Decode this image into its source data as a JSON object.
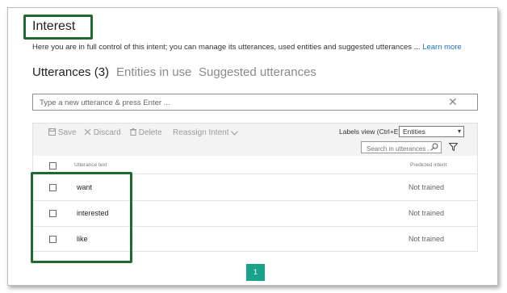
{
  "intent": {
    "title": "Interest",
    "description": "Here you are in full control of this intent; you can manage its utterances, used entities and suggested utterances ...",
    "learn_more": "Learn more"
  },
  "tabs": [
    {
      "label": "Utterances (3)",
      "active": true
    },
    {
      "label": "Entities in use",
      "active": false
    },
    {
      "label": "Suggested utterances",
      "active": false
    }
  ],
  "utterance_input": {
    "placeholder": "Type a new utterance & press Enter ...",
    "value": ""
  },
  "toolbar": {
    "save": "Save",
    "discard": "Discard",
    "delete": "Delete",
    "reassign": "Reassign Intent",
    "labels_view_label": "Labels view (Ctrl+E):",
    "labels_view_value": "Entities",
    "search_placeholder": "Search in utterances ..."
  },
  "table": {
    "columns": [
      "Utterance text",
      "Predicted intent"
    ],
    "rows": [
      {
        "text": "want",
        "status": "Not trained"
      },
      {
        "text": "interested",
        "status": "Not trained"
      },
      {
        "text": "like",
        "status": "Not trained"
      }
    ]
  },
  "pagination": {
    "current_page": "1"
  },
  "colors": {
    "highlight": "#1e6b30",
    "accent": "#1aa38c",
    "link": "#1a73c9"
  }
}
